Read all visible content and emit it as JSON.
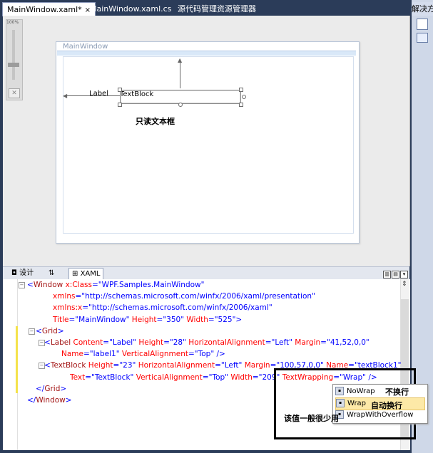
{
  "tabs": [
    {
      "label": "MainWindow.xaml*",
      "active": true,
      "close": "×"
    },
    {
      "label": "MainWindow.xaml.cs",
      "active": false
    },
    {
      "label": "源代码管理资源管理器",
      "active": false
    }
  ],
  "tab_dropdown": "▼",
  "solution_title": "解决方",
  "designer": {
    "zoom_label": "100%",
    "window_title": "MainWindow",
    "label_text": "Label",
    "textblock_text": "TextBlock",
    "annotation": "只读文本框"
  },
  "split_tabs": {
    "design": "设计",
    "swap": "⇅",
    "xaml": "XAML"
  },
  "code_lines": [
    {
      "indent": 0,
      "parts": [
        [
          "b",
          "<"
        ],
        [
          "t",
          "Window "
        ],
        [
          "a",
          "x:Class"
        ],
        [
          "b",
          "=\""
        ],
        [
          "v",
          "WPF.Samples.MainWindow"
        ],
        [
          "b",
          "\""
        ]
      ]
    },
    {
      "indent": 3,
      "parts": [
        [
          "a",
          "xmlns"
        ],
        [
          "b",
          "=\""
        ],
        [
          "v",
          "http://schemas.microsoft.com/winfx/2006/xaml/presentation"
        ],
        [
          "b",
          "\""
        ]
      ]
    },
    {
      "indent": 3,
      "parts": [
        [
          "a",
          "xmlns:x"
        ],
        [
          "b",
          "=\""
        ],
        [
          "v",
          "http://schemas.microsoft.com/winfx/2006/xaml"
        ],
        [
          "b",
          "\""
        ]
      ]
    },
    {
      "indent": 3,
      "parts": [
        [
          "a",
          "Title"
        ],
        [
          "b",
          "=\""
        ],
        [
          "v",
          "MainWindow"
        ],
        [
          "b",
          "\" "
        ],
        [
          "a",
          "Height"
        ],
        [
          "b",
          "=\""
        ],
        [
          "v",
          "350"
        ],
        [
          "b",
          "\" "
        ],
        [
          "a",
          "Width"
        ],
        [
          "b",
          "=\""
        ],
        [
          "v",
          "525"
        ],
        [
          "b",
          "\">"
        ]
      ]
    },
    {
      "indent": 1,
      "parts": [
        [
          "b",
          "<"
        ],
        [
          "t",
          "Grid"
        ],
        [
          "b",
          ">"
        ]
      ]
    },
    {
      "indent": 2,
      "parts": [
        [
          "b",
          "<"
        ],
        [
          "t",
          "Label "
        ],
        [
          "a",
          "Content"
        ],
        [
          "b",
          "=\""
        ],
        [
          "v",
          "Label"
        ],
        [
          "b",
          "\" "
        ],
        [
          "a",
          "Height"
        ],
        [
          "b",
          "=\""
        ],
        [
          "v",
          "28"
        ],
        [
          "b",
          "\" "
        ],
        [
          "a",
          "HorizontalAlignment"
        ],
        [
          "b",
          "=\""
        ],
        [
          "v",
          "Left"
        ],
        [
          "b",
          "\" "
        ],
        [
          "a",
          "Margin"
        ],
        [
          "b",
          "=\""
        ],
        [
          "v",
          "41,52,0,0"
        ],
        [
          "b",
          "\""
        ]
      ]
    },
    {
      "indent": 4,
      "parts": [
        [
          "a",
          "Name"
        ],
        [
          "b",
          "=\""
        ],
        [
          "v",
          "label1"
        ],
        [
          "b",
          "\" "
        ],
        [
          "a",
          "VerticalAlignment"
        ],
        [
          "b",
          "=\""
        ],
        [
          "v",
          "Top"
        ],
        [
          "b",
          "\" />"
        ]
      ]
    },
    {
      "indent": 2,
      "parts": [
        [
          "b",
          "<"
        ],
        [
          "t",
          "TextBlock "
        ],
        [
          "a",
          "Height"
        ],
        [
          "b",
          "=\""
        ],
        [
          "v",
          "23"
        ],
        [
          "b",
          "\" "
        ],
        [
          "a",
          "HorizontalAlignment"
        ],
        [
          "b",
          "=\""
        ],
        [
          "v",
          "Left"
        ],
        [
          "b",
          "\" "
        ],
        [
          "a",
          "Margin"
        ],
        [
          "b",
          "=\""
        ],
        [
          "v",
          "100,57,0,0"
        ],
        [
          "b",
          "\" "
        ],
        [
          "a",
          "Name"
        ],
        [
          "b",
          "=\""
        ],
        [
          "v",
          "textBlock1"
        ],
        [
          "b",
          "\""
        ]
      ]
    },
    {
      "indent": 5,
      "parts": [
        [
          "a",
          "Text"
        ],
        [
          "b",
          "=\""
        ],
        [
          "v",
          "TextBlock"
        ],
        [
          "b",
          "\" "
        ],
        [
          "a",
          "VerticalAlignment"
        ],
        [
          "b",
          "=\""
        ],
        [
          "v",
          "Top"
        ],
        [
          "b",
          "\" "
        ],
        [
          "a",
          "Width"
        ],
        [
          "b",
          "=\""
        ],
        [
          "v",
          "209"
        ],
        [
          "b",
          "\" "
        ],
        [
          "a",
          "TextWrapping"
        ],
        [
          "b",
          "=\""
        ],
        [
          "v",
          "Wrap"
        ],
        [
          "b",
          "\" />"
        ]
      ]
    },
    {
      "indent": 1,
      "parts": [
        [
          "b",
          "</"
        ],
        [
          "t",
          "Grid"
        ],
        [
          "b",
          ">"
        ]
      ]
    },
    {
      "indent": 0,
      "parts": [
        [
          "b",
          "</"
        ],
        [
          "t",
          "Window"
        ],
        [
          "b",
          ">"
        ]
      ]
    }
  ],
  "intellisense": {
    "items": [
      "NoWrap",
      "Wrap",
      "WrapWithOverflow"
    ],
    "selected": "Wrap"
  },
  "annotations": {
    "nowrap": "不换行",
    "wrap": "自动换行",
    "rare": "该值一般很少用"
  }
}
